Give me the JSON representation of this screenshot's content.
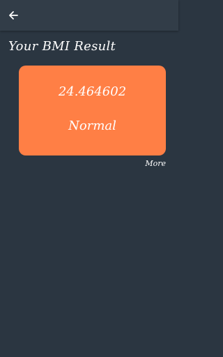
{
  "header": {
    "back_icon": "arrow-left-icon"
  },
  "page": {
    "title": "Your BMI Result"
  },
  "result": {
    "value": "24.464602",
    "category": "Normal",
    "card_color": "#ff7f45"
  },
  "more": {
    "label": "More"
  },
  "colors": {
    "background": "#2b3641",
    "app_bar": "#323d48",
    "text": "#ffffff"
  }
}
